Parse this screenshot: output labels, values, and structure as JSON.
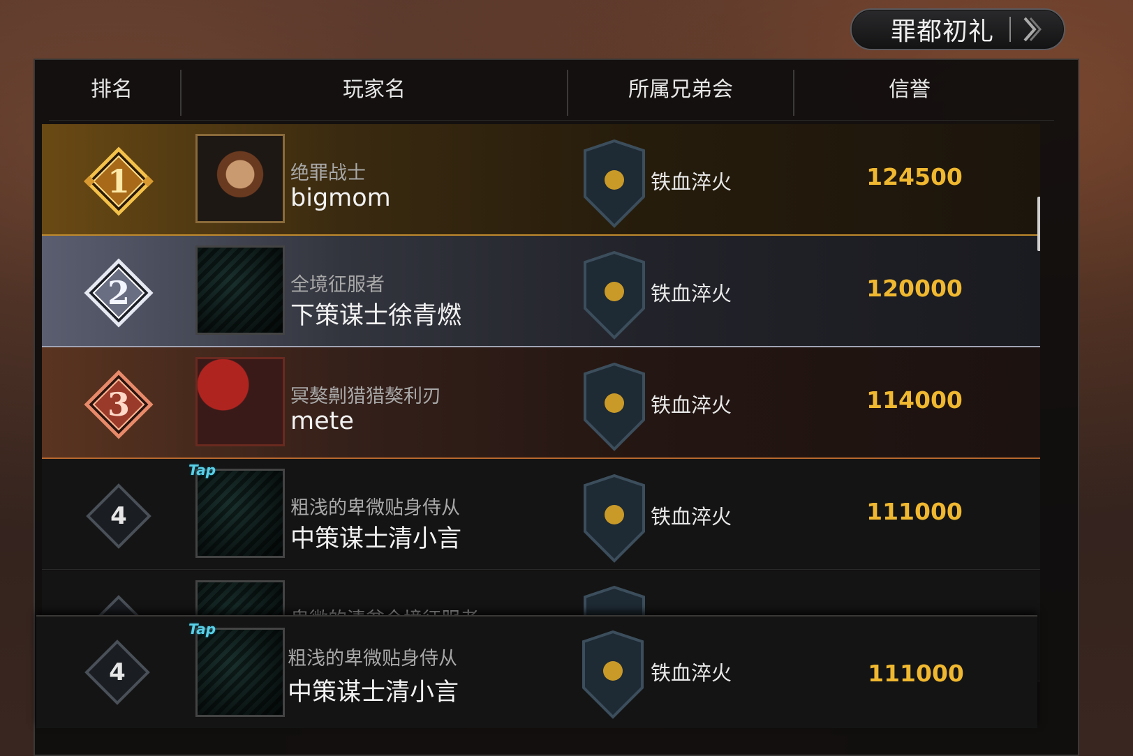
{
  "season_button": {
    "label": "罪都初礼",
    "icon": "chevron-right-icon"
  },
  "columns": {
    "rank": "排名",
    "player": "玩家名",
    "guild": "所属兄弟会",
    "reputation": "信誉"
  },
  "rows": [
    {
      "rank": "1",
      "title": "绝罪战士",
      "name": "bigmom",
      "guild": "铁血淬火",
      "reputation": "124500",
      "avatar": "pirate-captain"
    },
    {
      "rank": "2",
      "title": "全境征服者",
      "name": "下策谋士徐青燃",
      "guild": "铁血淬火",
      "reputation": "120000",
      "avatar": "dragon"
    },
    {
      "rank": "3",
      "title": "冥獒劓猎猎獒利刃",
      "name": "mete",
      "guild": "铁血淬火",
      "reputation": "114000",
      "avatar": "red-dragon"
    },
    {
      "rank": "4",
      "title": "粗浅的卑微贴身侍从",
      "name": "中策谋士清小言",
      "guild": "铁血淬火",
      "reputation": "111000",
      "avatar": "dragon",
      "tag": "Tap"
    },
    {
      "rank": "",
      "title": "卑微的清贫全境征服者",
      "name": "",
      "guild": "",
      "reputation": "",
      "avatar": "dragon"
    }
  ],
  "my_rank": {
    "rank": "4",
    "title": "粗浅的卑微贴身侍从",
    "name": "中策谋士清小言",
    "guild": "铁血淬火",
    "reputation": "111000",
    "tag": "Tap"
  },
  "colors": {
    "gold": "#c08a2c",
    "silver": "#a0a4b4",
    "bronze": "#b8682e",
    "reputation": "#f0b830",
    "tap": "#5ad0e8"
  }
}
